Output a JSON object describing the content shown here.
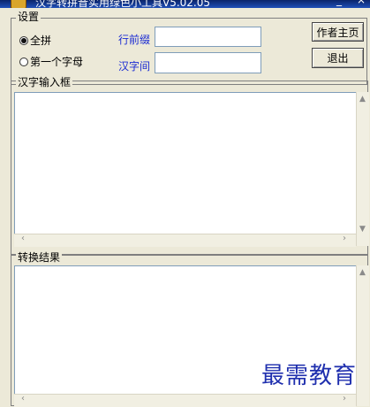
{
  "window": {
    "title": "汉字转拼音实用绿色小工具V5.02.05",
    "minimize": "_",
    "close": "×"
  },
  "settings": {
    "group_title": "设置",
    "radio_full": {
      "label": "全拼",
      "selected": true
    },
    "radio_first": {
      "label": "第一个字母",
      "selected": false
    },
    "prefix_label": "行前缀",
    "prefix_value": "",
    "between_label": "汉字间",
    "between_value": "",
    "author_button": "作者主页",
    "exit_button": "退出"
  },
  "input_panel": {
    "title": "汉字输入框",
    "content": ""
  },
  "result_panel": {
    "title": "转换结果",
    "content": ""
  },
  "scroll": {
    "left": "‹",
    "right": "›",
    "up": "▲",
    "down": "▼"
  },
  "watermark": "最需教育"
}
